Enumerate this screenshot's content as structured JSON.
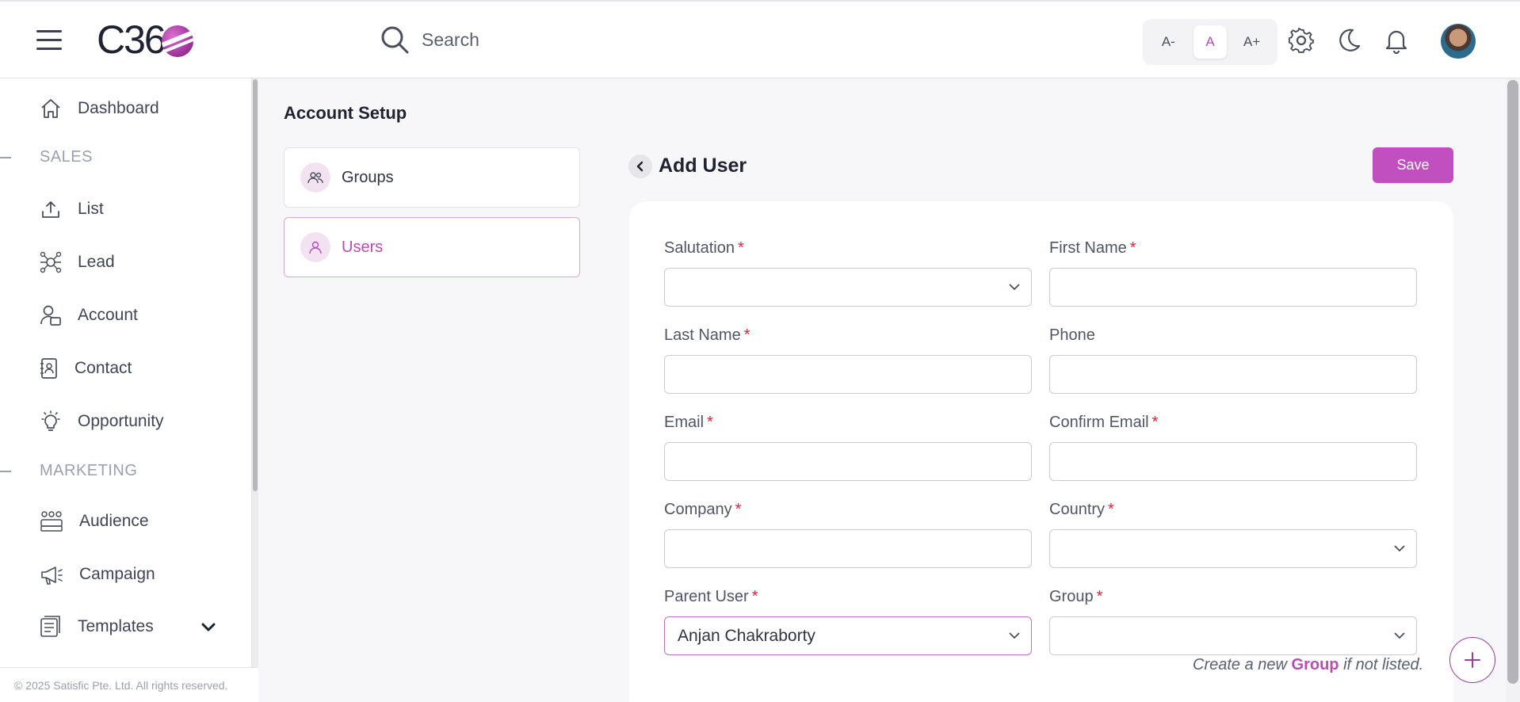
{
  "header": {
    "logo_text": "C36",
    "search_placeholder": "Search",
    "font_sizes": [
      "A-",
      "A",
      "A+"
    ],
    "accent": "#c24fbf"
  },
  "sidebar": {
    "items": [
      {
        "label": "Dashboard",
        "icon": "home-icon"
      },
      {
        "label": "List",
        "icon": "upload-icon"
      },
      {
        "label": "Lead",
        "icon": "network-icon"
      },
      {
        "label": "Account",
        "icon": "account-icon"
      },
      {
        "label": "Contact",
        "icon": "contact-book-icon"
      },
      {
        "label": "Opportunity",
        "icon": "lightbulb-icon"
      },
      {
        "label": "Audience",
        "icon": "audience-icon"
      },
      {
        "label": "Campaign",
        "icon": "megaphone-icon"
      },
      {
        "label": "Templates",
        "icon": "templates-icon"
      }
    ],
    "sections": [
      "SALES",
      "MARKETING"
    ],
    "footer": "© 2025 Satisfic Pte. Ltd. All rights reserved."
  },
  "main": {
    "page_title": "Account Setup",
    "cards": [
      {
        "label": "Groups",
        "icon": "group-icon"
      },
      {
        "label": "Users",
        "icon": "user-icon"
      }
    ],
    "form_title": "Add User",
    "save_label": "Save",
    "fields": [
      {
        "label": "Salutation",
        "required": "*",
        "value": ""
      },
      {
        "label": "First Name",
        "required": "*",
        "value": ""
      },
      {
        "label": "Last Name",
        "required": "*",
        "value": ""
      },
      {
        "label": "Phone",
        "required": "",
        "value": ""
      },
      {
        "label": "Email",
        "required": "*",
        "value": ""
      },
      {
        "label": "Confirm Email",
        "required": "*",
        "value": ""
      },
      {
        "label": "Company",
        "required": "*",
        "value": ""
      },
      {
        "label": "Country",
        "required": "*",
        "value": ""
      },
      {
        "label": "Parent User",
        "required": "*",
        "value": "Anjan Chakraborty"
      },
      {
        "label": "Group",
        "required": "*",
        "value": ""
      }
    ],
    "hint": {
      "prefix": "Create a new ",
      "link": "Group",
      "suffix": " if not listed."
    }
  }
}
